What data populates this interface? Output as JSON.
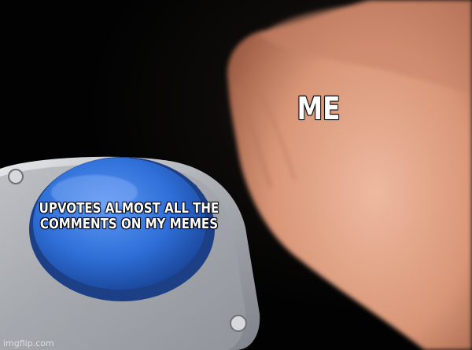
{
  "meme": {
    "hand_caption": "ME",
    "button_caption": "UPVOTES ALMOST ALL THE COMMENTS ON MY MEMES",
    "watermark": "imgflip.com"
  },
  "colors": {
    "button_blue": "#2f6fd8",
    "button_housing": "#b9bcc2",
    "skin": "#e3a88f",
    "background": "#050505"
  }
}
